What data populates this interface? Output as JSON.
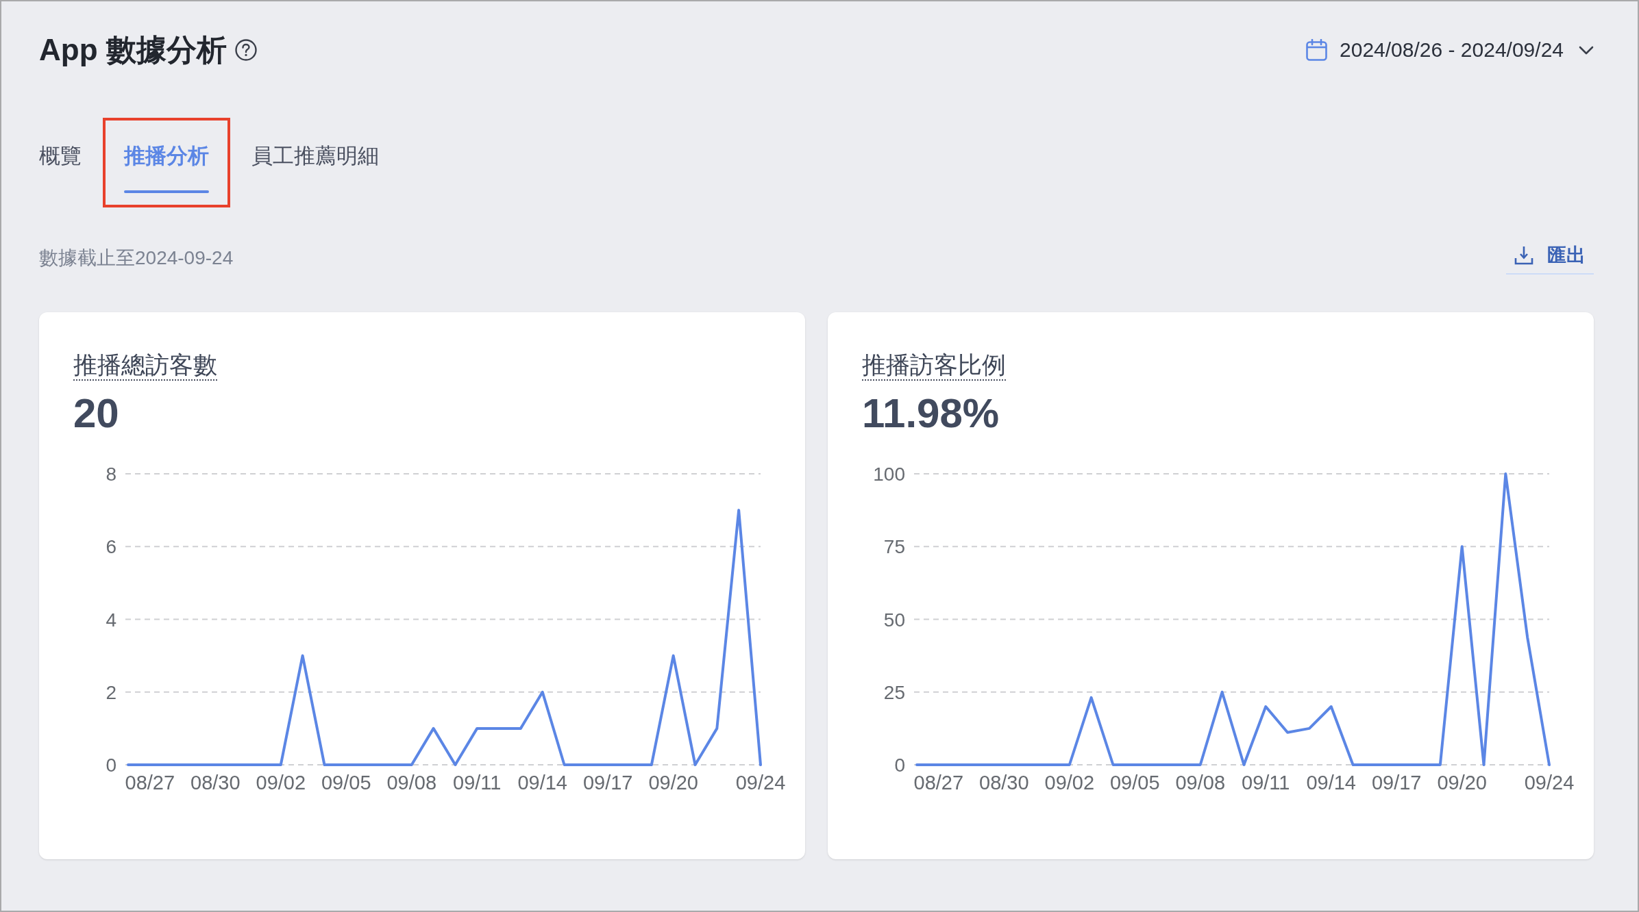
{
  "header": {
    "title": "App 數據分析",
    "date_range": "2024/08/26 - 2024/09/24"
  },
  "tabs": [
    {
      "label": "概覽",
      "selected": false,
      "highlighted": false
    },
    {
      "label": "推播分析",
      "selected": true,
      "highlighted": true
    },
    {
      "label": "員工推薦明細",
      "selected": false,
      "highlighted": false
    }
  ],
  "data_note": "數據截止至2024-09-24",
  "export_button": "匯出",
  "cards": [
    {
      "title": "推播總訪客數",
      "value": "20",
      "chart_data": {
        "type": "line",
        "categories": [
          null,
          "08/27",
          null,
          null,
          "08/30",
          null,
          null,
          "09/02",
          null,
          null,
          "09/05",
          null,
          null,
          "09/08",
          null,
          null,
          "09/11",
          null,
          null,
          "09/14",
          null,
          null,
          "09/17",
          null,
          null,
          "09/20",
          null,
          null,
          null,
          "09/24"
        ],
        "values": [
          0,
          0,
          0,
          0,
          0,
          0,
          0,
          0,
          3,
          0,
          0,
          0,
          0,
          0,
          1,
          0,
          1,
          1,
          1,
          2,
          0,
          0,
          0,
          0,
          0,
          3,
          0,
          1,
          7,
          0
        ],
        "color": "#5b86e5",
        "ylim": [
          0,
          8
        ],
        "yticks": [
          0,
          2,
          4,
          6,
          8
        ],
        "grid": true
      }
    },
    {
      "title": "推播訪客比例",
      "value": "11.98%",
      "chart_data": {
        "type": "line",
        "categories": [
          null,
          "08/27",
          null,
          null,
          "08/30",
          null,
          null,
          "09/02",
          null,
          null,
          "09/05",
          null,
          null,
          "09/08",
          null,
          null,
          "09/11",
          null,
          null,
          "09/14",
          null,
          null,
          "09/17",
          null,
          null,
          "09/20",
          null,
          null,
          null,
          "09/24"
        ],
        "values": [
          0,
          0,
          0,
          0,
          0,
          0,
          0,
          0,
          23.1,
          0,
          0,
          0,
          0,
          0,
          25,
          0,
          20,
          11.1,
          12.5,
          20,
          0,
          0,
          0,
          0,
          0,
          75,
          0,
          100,
          43.8,
          0
        ],
        "color": "#5b86e5",
        "ylim": [
          0,
          100
        ],
        "yticks": [
          0,
          25,
          50,
          75,
          100
        ],
        "grid": true
      }
    }
  ]
}
